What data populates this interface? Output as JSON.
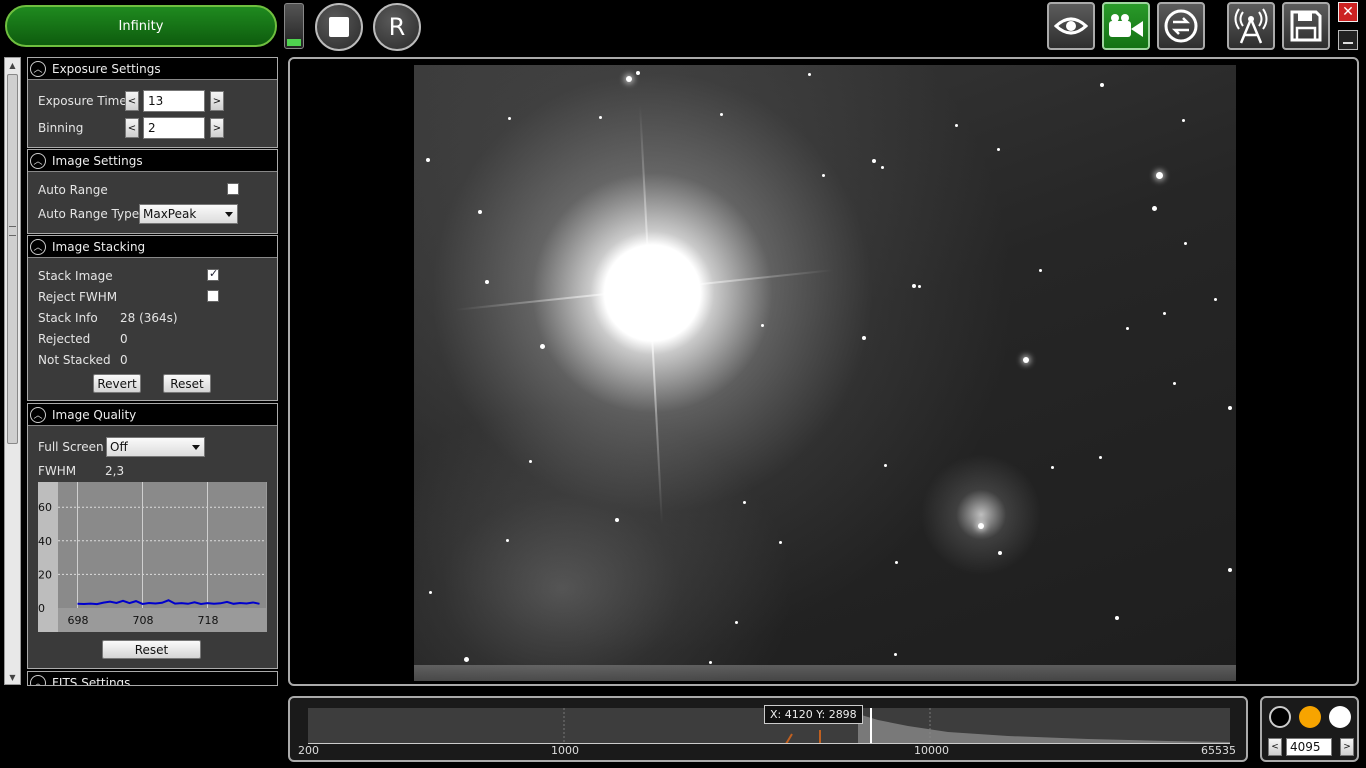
{
  "topbar": {
    "mode_label": "Infinity",
    "record_letter": "R"
  },
  "sections": {
    "exposure": {
      "title": "Exposure Settings",
      "exposure_time_label": "Exposure Time",
      "exposure_time_value": "13",
      "binning_label": "Binning",
      "binning_value": "2"
    },
    "image_settings": {
      "title": "Image Settings",
      "auto_range_label": "Auto Range",
      "auto_range_checked": false,
      "auto_range_type_label": "Auto Range Type",
      "auto_range_type_value": "MaxPeak"
    },
    "stacking": {
      "title": "Image Stacking",
      "stack_image_label": "Stack Image",
      "stack_image_checked": true,
      "reject_fwhm_label": "Reject FWHM",
      "reject_fwhm_checked": false,
      "stack_info_label": "Stack Info",
      "stack_info_value": "28 (364s)",
      "rejected_label": "Rejected",
      "rejected_value": "0",
      "not_stacked_label": "Not Stacked",
      "not_stacked_value": "0",
      "revert_label": "Revert",
      "reset_label": "Reset"
    },
    "quality": {
      "title": "Image Quality",
      "full_screen_label": "Full Screen",
      "full_screen_value": "Off",
      "fwhm_label": "FWHM",
      "fwhm_value": "2,3",
      "reset_label": "Reset"
    },
    "fits": {
      "title": "FITS Settings"
    }
  },
  "chart_data": {
    "type": "line",
    "x_ticks": [
      "698",
      "708",
      "718"
    ],
    "y_ticks": [
      "0",
      "20",
      "40",
      "60"
    ],
    "xlim": [
      695,
      727
    ],
    "ylim": [
      0,
      75
    ],
    "series": [
      {
        "color": "#0000cc",
        "x": [
          698,
          699,
          700,
          701,
          702,
          703,
          704,
          705,
          706,
          707,
          708,
          709,
          710,
          711,
          712,
          713,
          714,
          715,
          716,
          717,
          718,
          719,
          720,
          721,
          722,
          723,
          724,
          725,
          726
        ],
        "y": [
          2.5,
          2.4,
          2.6,
          2.3,
          3.2,
          3.8,
          3.0,
          4.3,
          2.9,
          4.1,
          2.4,
          3.0,
          2.7,
          3.1,
          4.6,
          2.6,
          2.9,
          2.5,
          3.4,
          2.4,
          2.9,
          2.5,
          2.8,
          3.6,
          2.5,
          3.0,
          2.7,
          3.3,
          2.5
        ]
      }
    ]
  },
  "histogram": {
    "tooltip": "X: 4120 Y: 2898",
    "ticks": [
      "200",
      "1000",
      "10000",
      "65535"
    ]
  },
  "color_panel": {
    "value": "4095"
  }
}
